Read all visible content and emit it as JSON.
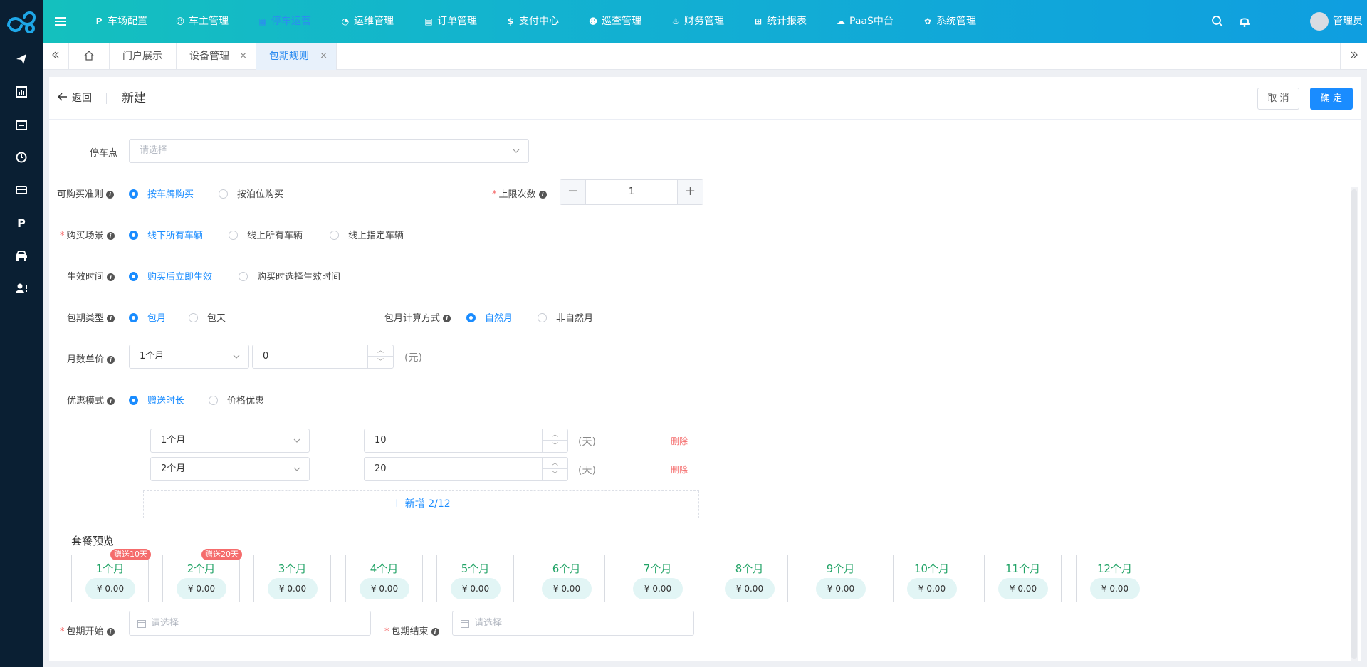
{
  "nav": {
    "items": [
      {
        "icon": "P",
        "label": "车场配置"
      },
      {
        "icon": "☺",
        "label": "车主管理"
      },
      {
        "icon": "▦",
        "label": "停车运营"
      },
      {
        "icon": "◔",
        "label": "运维管理"
      },
      {
        "icon": "▤",
        "label": "订单管理"
      },
      {
        "icon": "$",
        "label": "支付中心"
      },
      {
        "icon": "☻",
        "label": "巡查管理"
      },
      {
        "icon": "♨",
        "label": "财务管理"
      },
      {
        "icon": "⊞",
        "label": "统计报表"
      },
      {
        "icon": "☁",
        "label": "PaaS中台"
      },
      {
        "icon": "✿",
        "label": "系统管理"
      }
    ],
    "active": "停车运营",
    "user": "管理员"
  },
  "tabs": {
    "items": [
      {
        "label": "门户展示"
      },
      {
        "label": "设备管理"
      },
      {
        "label": "包期规则"
      }
    ],
    "close_glyph": "×"
  },
  "header": {
    "back_label": "返回",
    "title": "新建",
    "cancel_label": "取 消",
    "confirm_label": "确 定"
  },
  "form": {
    "parking": {
      "label": "停车点",
      "placeholder": "请选择"
    },
    "purchase_rule": {
      "label": "可购买准则",
      "options": [
        "按车牌购买",
        "按泊位购买"
      ],
      "selected": "按车牌购买"
    },
    "limit": {
      "label": "上限次数",
      "value": "1",
      "minus": "−",
      "plus": "+"
    },
    "scene": {
      "label": "购买场景",
      "options": [
        "线下所有车辆",
        "线上所有车辆",
        "线上指定车辆"
      ],
      "selected": "线下所有车辆"
    },
    "effective": {
      "label": "生效时间",
      "options": [
        "购买后立即生效",
        "购买时选择生效时间"
      ],
      "selected": "购买后立即生效"
    },
    "period_type": {
      "label": "包期类型",
      "options": [
        "包月",
        "包天"
      ],
      "selected": "包月"
    },
    "month_calc": {
      "label": "包月计算方式",
      "options": [
        "自然月",
        "非自然月"
      ],
      "selected": "自然月"
    },
    "unit_price": {
      "label": "月数单价",
      "month": "1个月",
      "value": "0",
      "unit": "(元)"
    },
    "discount": {
      "label": "优惠模式",
      "options": [
        "赠送时长",
        "价格优惠"
      ],
      "selected": "赠送时长"
    },
    "discount_rows": [
      {
        "month": "1个月",
        "value": "10",
        "unit": "(天)",
        "delete": "删除"
      },
      {
        "month": "2个月",
        "value": "20",
        "unit": "(天)",
        "delete": "删除"
      }
    ],
    "add_label": "＋ 新增 2/12",
    "period_start": {
      "label": "包期开始",
      "placeholder": "请选择"
    },
    "period_end": {
      "label": "包期结束",
      "placeholder": "请选择"
    }
  },
  "preview": {
    "title": "套餐预览",
    "cards": [
      {
        "month": "1个月",
        "price": "¥ 0.00",
        "badge": "赠送10天"
      },
      {
        "month": "2个月",
        "price": "¥ 0.00",
        "badge": "赠送20天"
      },
      {
        "month": "3个月",
        "price": "¥ 0.00",
        "badge": ""
      },
      {
        "month": "4个月",
        "price": "¥ 0.00",
        "badge": ""
      },
      {
        "month": "5个月",
        "price": "¥ 0.00",
        "badge": ""
      },
      {
        "month": "6个月",
        "price": "¥ 0.00",
        "badge": ""
      },
      {
        "month": "7个月",
        "price": "¥ 0.00",
        "badge": ""
      },
      {
        "month": "8个月",
        "price": "¥ 0.00",
        "badge": ""
      },
      {
        "month": "9个月",
        "price": "¥ 0.00",
        "badge": ""
      },
      {
        "month": "10个月",
        "price": "¥ 0.00",
        "badge": ""
      },
      {
        "month": "11个月",
        "price": "¥ 0.00",
        "badge": ""
      },
      {
        "month": "12个月",
        "price": "¥ 0.00",
        "badge": ""
      }
    ]
  },
  "colors": {
    "accent": "#1a8cff",
    "danger": "#f56c6c",
    "green": "#21a366",
    "sidebar": "#0a1f33"
  }
}
